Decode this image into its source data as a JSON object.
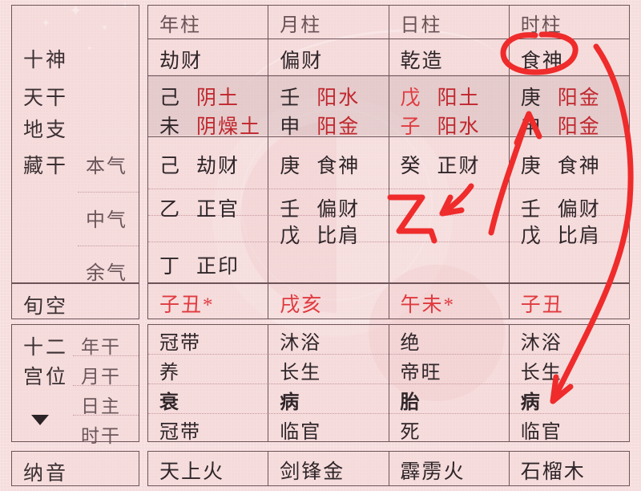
{
  "sidebar": {
    "top_labels": [
      "十神",
      "天干",
      "地支",
      "藏干"
    ],
    "hidden_stem_rows": [
      "本气",
      "中气",
      "余气"
    ],
    "xunkong_label": "旬空",
    "palace": {
      "title_line1": "十二",
      "title_line2": "宫位",
      "dropdown_icon": "triangle-down-icon",
      "rows": [
        "年干",
        "月干",
        "日主",
        "时干"
      ]
    },
    "nayin_label": "纳音"
  },
  "grid": {
    "headers": [
      "年柱",
      "月柱",
      "日柱",
      "时柱"
    ],
    "ten_gods": [
      "劫财",
      "偏财",
      "乾造",
      "食神"
    ],
    "heavenly_stems": [
      {
        "stem": "己",
        "element": "阴土",
        "stem_red": false
      },
      {
        "stem": "壬",
        "element": "阳水",
        "stem_red": false
      },
      {
        "stem": "戊",
        "element": "阳土",
        "stem_red": true
      },
      {
        "stem": "庚",
        "element": "阳金",
        "stem_red": false
      }
    ],
    "earthly_branches": [
      {
        "branch": "未",
        "element": "阴燥土",
        "branch_red": false
      },
      {
        "branch": "申",
        "element": "阳金",
        "branch_red": false
      },
      {
        "branch": "子",
        "element": "阳水",
        "branch_red": true
      },
      {
        "branch": "申",
        "element": "阳金",
        "branch_red": false
      }
    ],
    "hidden_stems": {
      "ben_qi": [
        {
          "stem": "己",
          "god": "劫财"
        },
        {
          "stem": "庚",
          "god": "食神"
        },
        {
          "stem": "癸",
          "god": "正财"
        },
        {
          "stem": "庚",
          "god": "食神"
        }
      ],
      "zhong_qi": [
        {
          "stem": "乙",
          "god": "正官"
        },
        {
          "stem": "壬",
          "god": "偏财"
        },
        {
          "stem": "",
          "god": ""
        },
        {
          "stem": "壬",
          "god": "偏财"
        }
      ],
      "zhong_qi2": [
        {
          "stem": "",
          "god": ""
        },
        {
          "stem": "戊",
          "god": "比肩"
        },
        {
          "stem": "",
          "god": ""
        },
        {
          "stem": "戊",
          "god": "比肩"
        }
      ],
      "yu_qi": [
        {
          "stem": "丁",
          "god": "正印"
        },
        {
          "stem": "",
          "god": ""
        },
        {
          "stem": "",
          "god": ""
        },
        {
          "stem": "",
          "god": ""
        }
      ]
    },
    "xunkong": [
      "子丑*",
      "戌亥",
      "午未*",
      "子丑"
    ],
    "palace_rows": [
      [
        "冠带",
        "沐浴",
        "绝",
        "沐浴"
      ],
      [
        "养",
        "长生",
        "帝旺",
        "长生"
      ],
      [
        "衰",
        "病",
        "胎",
        "病"
      ],
      [
        "冠带",
        "临官",
        "死",
        "临官"
      ]
    ],
    "nayin": [
      "天上火",
      "剑锋金",
      "霹雳火",
      "石榴木"
    ]
  },
  "annotations": {
    "circle_target": "食神",
    "arrow_up_target": "庚",
    "handwritten_char": "乙",
    "arrow_down_target": "临官",
    "ink_color": "#ef2b2b"
  }
}
